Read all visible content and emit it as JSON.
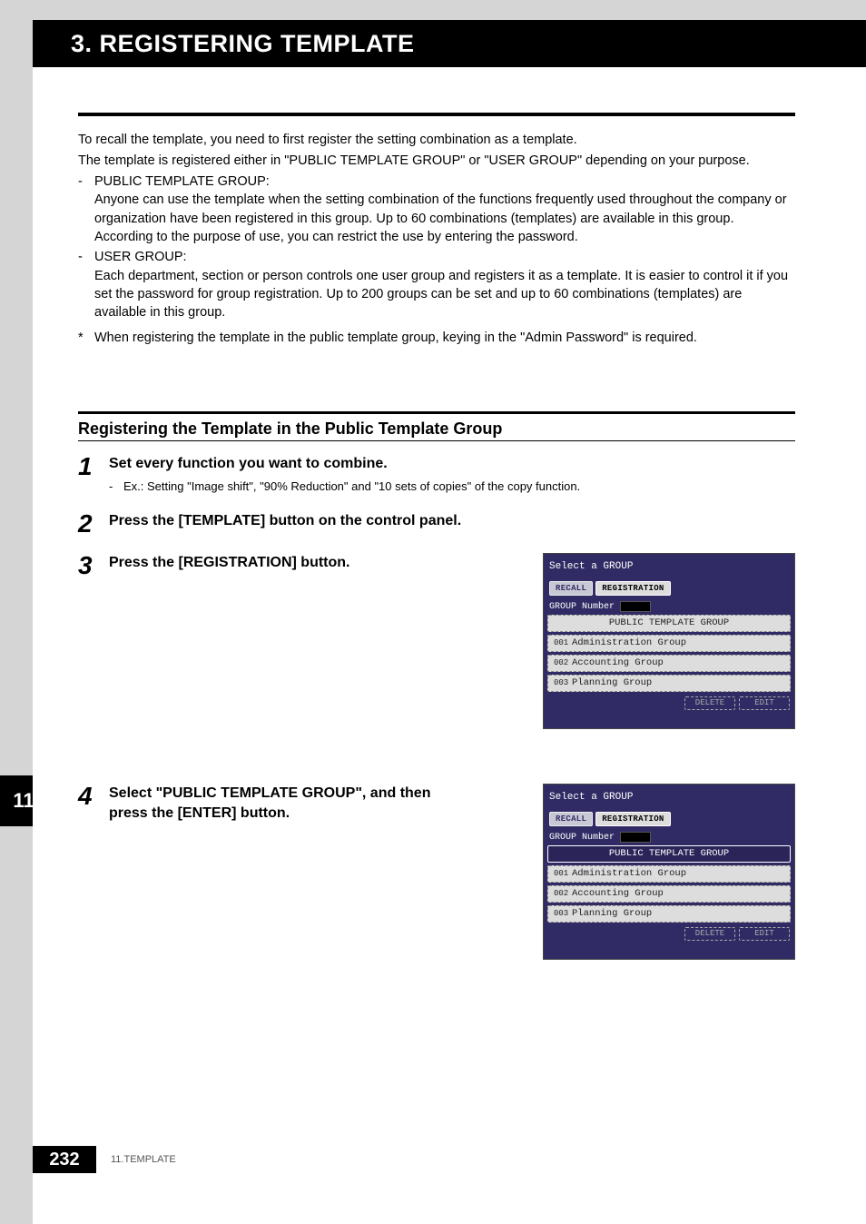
{
  "header": {
    "title": "3. REGISTERING TEMPLATE"
  },
  "intro": {
    "p1": "To recall the template, you need to first register the setting combination as a template.",
    "p2": "The template is registered either in \"PUBLIC TEMPLATE GROUP\" or \"USER GROUP\" depending on your purpose."
  },
  "groups": {
    "public": {
      "label": "PUBLIC TEMPLATE GROUP:",
      "body": "Anyone can use the template when the setting combination of the functions frequently used throughout the company or organization have been registered in this group. Up to 60 combinations (templates) are available in this group. According to the purpose of use, you can restrict the use by entering the password."
    },
    "user": {
      "label": "USER GROUP:",
      "body": "Each department, section or person controls one user group and registers it as a template. It is easier to control it if you set the password for group registration. Up to 200 groups can be set and up to 60 combinations (templates) are available in this group."
    }
  },
  "note": "When registering the template in the public template group, keying in the \"Admin Password\" is required.",
  "section_title": "Registering the Template in the Public Template Group",
  "steps": {
    "1": {
      "num": "1",
      "head": "Set every function you want to combine.",
      "sub": "Ex.: Setting \"Image shift\", \"90% Reduction\" and \"10 sets of copies\" of the copy function."
    },
    "2": {
      "num": "2",
      "head": "Press the [TEMPLATE] button on the control panel."
    },
    "3": {
      "num": "3",
      "head": "Press the [REGISTRATION] button."
    },
    "4": {
      "num": "4",
      "head": "Select \"PUBLIC TEMPLATE GROUP\", and then press the [ENTER] button."
    }
  },
  "panel": {
    "title": "Select a GROUP",
    "tab_recall": "RECALL",
    "tab_reg": "REGISTRATION",
    "group_number_label": "GROUP Number",
    "items": [
      {
        "id": "",
        "name": "PUBLIC TEMPLATE GROUP"
      },
      {
        "id": "001",
        "name": "Administration Group"
      },
      {
        "id": "002",
        "name": "Accounting Group"
      },
      {
        "id": "003",
        "name": "Planning Group"
      }
    ],
    "btn_delete": "DELETE",
    "btn_edit": "EDIT"
  },
  "side_tab": "11",
  "footer": {
    "page": "232",
    "chapter": "11.TEMPLATE"
  }
}
